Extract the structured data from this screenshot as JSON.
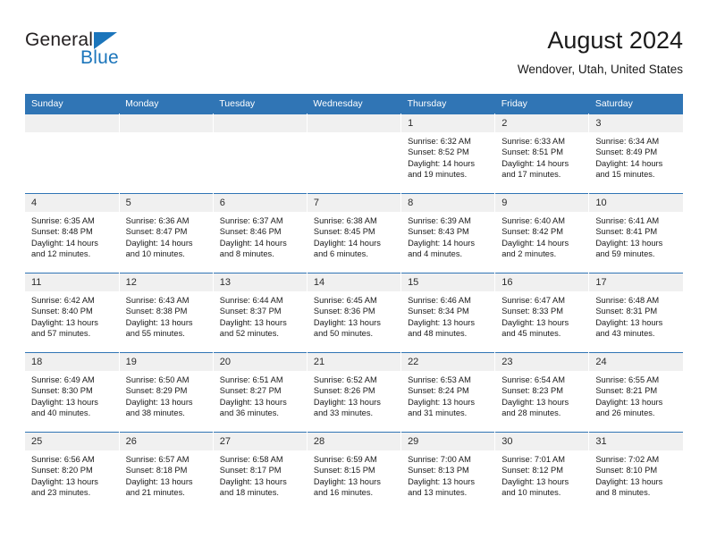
{
  "brand": {
    "name_top": "General",
    "name_bottom": "Blue",
    "triangle_color": "#1b75bb"
  },
  "header": {
    "title": "August 2024",
    "location": "Wendover, Utah, United States"
  },
  "theme": {
    "header_blue": "#3075b5",
    "daynum_band": "#f0f0f0",
    "text": "#1a1a1a"
  },
  "weekdays": [
    "Sunday",
    "Monday",
    "Tuesday",
    "Wednesday",
    "Thursday",
    "Friday",
    "Saturday"
  ],
  "labels": {
    "sunrise_prefix": "Sunrise:",
    "sunset_prefix": "Sunset:",
    "daylight_prefix": "Daylight:"
  },
  "weeks": [
    [
      {
        "day": "",
        "sunrise": "",
        "sunset": "",
        "daylight": ""
      },
      {
        "day": "",
        "sunrise": "",
        "sunset": "",
        "daylight": ""
      },
      {
        "day": "",
        "sunrise": "",
        "sunset": "",
        "daylight": ""
      },
      {
        "day": "",
        "sunrise": "",
        "sunset": "",
        "daylight": ""
      },
      {
        "day": "1",
        "sunrise": "Sunrise: 6:32 AM",
        "sunset": "Sunset: 8:52 PM",
        "daylight": "Daylight: 14 hours and 19 minutes."
      },
      {
        "day": "2",
        "sunrise": "Sunrise: 6:33 AM",
        "sunset": "Sunset: 8:51 PM",
        "daylight": "Daylight: 14 hours and 17 minutes."
      },
      {
        "day": "3",
        "sunrise": "Sunrise: 6:34 AM",
        "sunset": "Sunset: 8:49 PM",
        "daylight": "Daylight: 14 hours and 15 minutes."
      }
    ],
    [
      {
        "day": "4",
        "sunrise": "Sunrise: 6:35 AM",
        "sunset": "Sunset: 8:48 PM",
        "daylight": "Daylight: 14 hours and 12 minutes."
      },
      {
        "day": "5",
        "sunrise": "Sunrise: 6:36 AM",
        "sunset": "Sunset: 8:47 PM",
        "daylight": "Daylight: 14 hours and 10 minutes."
      },
      {
        "day": "6",
        "sunrise": "Sunrise: 6:37 AM",
        "sunset": "Sunset: 8:46 PM",
        "daylight": "Daylight: 14 hours and 8 minutes."
      },
      {
        "day": "7",
        "sunrise": "Sunrise: 6:38 AM",
        "sunset": "Sunset: 8:45 PM",
        "daylight": "Daylight: 14 hours and 6 minutes."
      },
      {
        "day": "8",
        "sunrise": "Sunrise: 6:39 AM",
        "sunset": "Sunset: 8:43 PM",
        "daylight": "Daylight: 14 hours and 4 minutes."
      },
      {
        "day": "9",
        "sunrise": "Sunrise: 6:40 AM",
        "sunset": "Sunset: 8:42 PM",
        "daylight": "Daylight: 14 hours and 2 minutes."
      },
      {
        "day": "10",
        "sunrise": "Sunrise: 6:41 AM",
        "sunset": "Sunset: 8:41 PM",
        "daylight": "Daylight: 13 hours and 59 minutes."
      }
    ],
    [
      {
        "day": "11",
        "sunrise": "Sunrise: 6:42 AM",
        "sunset": "Sunset: 8:40 PM",
        "daylight": "Daylight: 13 hours and 57 minutes."
      },
      {
        "day": "12",
        "sunrise": "Sunrise: 6:43 AM",
        "sunset": "Sunset: 8:38 PM",
        "daylight": "Daylight: 13 hours and 55 minutes."
      },
      {
        "day": "13",
        "sunrise": "Sunrise: 6:44 AM",
        "sunset": "Sunset: 8:37 PM",
        "daylight": "Daylight: 13 hours and 52 minutes."
      },
      {
        "day": "14",
        "sunrise": "Sunrise: 6:45 AM",
        "sunset": "Sunset: 8:36 PM",
        "daylight": "Daylight: 13 hours and 50 minutes."
      },
      {
        "day": "15",
        "sunrise": "Sunrise: 6:46 AM",
        "sunset": "Sunset: 8:34 PM",
        "daylight": "Daylight: 13 hours and 48 minutes."
      },
      {
        "day": "16",
        "sunrise": "Sunrise: 6:47 AM",
        "sunset": "Sunset: 8:33 PM",
        "daylight": "Daylight: 13 hours and 45 minutes."
      },
      {
        "day": "17",
        "sunrise": "Sunrise: 6:48 AM",
        "sunset": "Sunset: 8:31 PM",
        "daylight": "Daylight: 13 hours and 43 minutes."
      }
    ],
    [
      {
        "day": "18",
        "sunrise": "Sunrise: 6:49 AM",
        "sunset": "Sunset: 8:30 PM",
        "daylight": "Daylight: 13 hours and 40 minutes."
      },
      {
        "day": "19",
        "sunrise": "Sunrise: 6:50 AM",
        "sunset": "Sunset: 8:29 PM",
        "daylight": "Daylight: 13 hours and 38 minutes."
      },
      {
        "day": "20",
        "sunrise": "Sunrise: 6:51 AM",
        "sunset": "Sunset: 8:27 PM",
        "daylight": "Daylight: 13 hours and 36 minutes."
      },
      {
        "day": "21",
        "sunrise": "Sunrise: 6:52 AM",
        "sunset": "Sunset: 8:26 PM",
        "daylight": "Daylight: 13 hours and 33 minutes."
      },
      {
        "day": "22",
        "sunrise": "Sunrise: 6:53 AM",
        "sunset": "Sunset: 8:24 PM",
        "daylight": "Daylight: 13 hours and 31 minutes."
      },
      {
        "day": "23",
        "sunrise": "Sunrise: 6:54 AM",
        "sunset": "Sunset: 8:23 PM",
        "daylight": "Daylight: 13 hours and 28 minutes."
      },
      {
        "day": "24",
        "sunrise": "Sunrise: 6:55 AM",
        "sunset": "Sunset: 8:21 PM",
        "daylight": "Daylight: 13 hours and 26 minutes."
      }
    ],
    [
      {
        "day": "25",
        "sunrise": "Sunrise: 6:56 AM",
        "sunset": "Sunset: 8:20 PM",
        "daylight": "Daylight: 13 hours and 23 minutes."
      },
      {
        "day": "26",
        "sunrise": "Sunrise: 6:57 AM",
        "sunset": "Sunset: 8:18 PM",
        "daylight": "Daylight: 13 hours and 21 minutes."
      },
      {
        "day": "27",
        "sunrise": "Sunrise: 6:58 AM",
        "sunset": "Sunset: 8:17 PM",
        "daylight": "Daylight: 13 hours and 18 minutes."
      },
      {
        "day": "28",
        "sunrise": "Sunrise: 6:59 AM",
        "sunset": "Sunset: 8:15 PM",
        "daylight": "Daylight: 13 hours and 16 minutes."
      },
      {
        "day": "29",
        "sunrise": "Sunrise: 7:00 AM",
        "sunset": "Sunset: 8:13 PM",
        "daylight": "Daylight: 13 hours and 13 minutes."
      },
      {
        "day": "30",
        "sunrise": "Sunrise: 7:01 AM",
        "sunset": "Sunset: 8:12 PM",
        "daylight": "Daylight: 13 hours and 10 minutes."
      },
      {
        "day": "31",
        "sunrise": "Sunrise: 7:02 AM",
        "sunset": "Sunset: 8:10 PM",
        "daylight": "Daylight: 13 hours and 8 minutes."
      }
    ]
  ]
}
